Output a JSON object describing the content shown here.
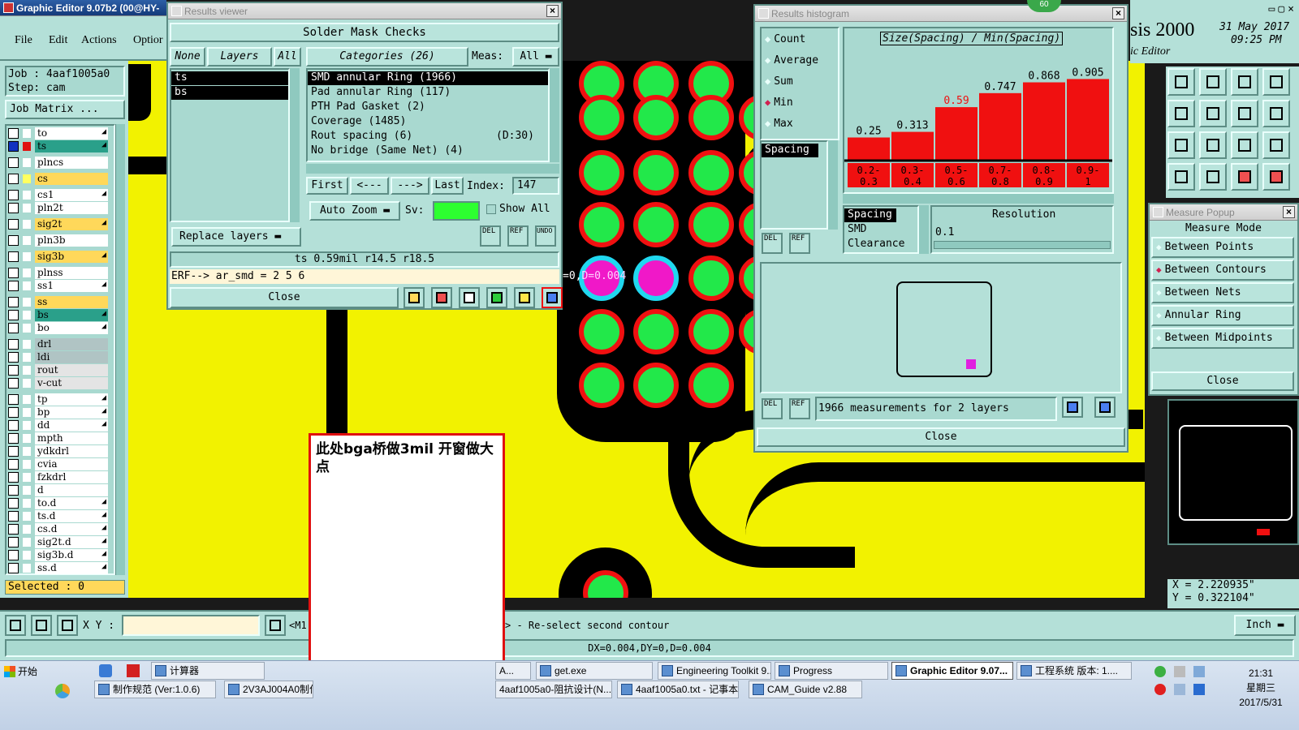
{
  "main_window": {
    "title": "Graphic Editor 9.07b2 (00@HY-H",
    "menu": [
      "File",
      "Edit",
      "Actions",
      "Optior"
    ],
    "job_label": "Job : 4aaf1005a0",
    "step_label": "Step: cam",
    "job_matrix_button": "Job Matrix ...",
    "selected_status": "Selected : 0",
    "app_brand": "sis 2000",
    "app_subtitle": "ic Editor",
    "date": "31 May 2017",
    "time": "09:25 PM",
    "indicator": "60"
  },
  "layers": [
    {
      "name": "to",
      "color": "#ffffff",
      "swatch": "#ffffff",
      "arrow": true
    },
    {
      "name": "ts",
      "color": "#2aa08a",
      "swatch": "#e01010",
      "arrow": true,
      "active": true
    },
    {
      "name": "plncs",
      "color": "#ffffff",
      "swatch": "#ffffff",
      "arrow": false
    },
    {
      "name": "cs",
      "color": "#ffd85a",
      "swatch": "#ffff60",
      "arrow": false
    },
    {
      "name": "cs1",
      "color": "#ffffff",
      "swatch": "#ffffff",
      "arrow": true
    },
    {
      "name": "pln2t",
      "color": "#ffffff",
      "swatch": "#ffffff",
      "arrow": false
    },
    {
      "name": "sig2t",
      "color": "#ffd85a",
      "swatch": "#ffffff",
      "arrow": true
    },
    {
      "name": "pln3b",
      "color": "#ffffff",
      "swatch": "#ffffff",
      "arrow": false
    },
    {
      "name": "sig3b",
      "color": "#ffd85a",
      "swatch": "#ffffff",
      "arrow": true
    },
    {
      "name": "plnss",
      "color": "#ffffff",
      "swatch": "#ffffff",
      "arrow": false
    },
    {
      "name": "ss1",
      "color": "#ffffff",
      "swatch": "#ffffff",
      "arrow": true
    },
    {
      "name": "ss",
      "color": "#ffd85a",
      "swatch": "#ffffff",
      "arrow": false
    },
    {
      "name": "bs",
      "color": "#2aa08a",
      "swatch": "#ffffff",
      "arrow": true
    },
    {
      "name": "bo",
      "color": "#ffffff",
      "swatch": "#ffffff",
      "arrow": true
    },
    {
      "name": "drl",
      "color": "#b0c4c4",
      "swatch": "#ffffff",
      "arrow": false
    },
    {
      "name": "ldi",
      "color": "#b0c4c4",
      "swatch": "#ffffff",
      "arrow": false
    },
    {
      "name": "rout",
      "color": "#e4e4e4",
      "swatch": "#ffffff",
      "arrow": false
    },
    {
      "name": "v-cut",
      "color": "#e4e4e4",
      "swatch": "#ffffff",
      "arrow": false
    },
    {
      "name": "tp",
      "color": "#ffffff",
      "swatch": "#ffffff",
      "arrow": true
    },
    {
      "name": "bp",
      "color": "#ffffff",
      "swatch": "#ffffff",
      "arrow": true
    },
    {
      "name": "dd",
      "color": "#ffffff",
      "swatch": "#ffffff",
      "arrow": true
    },
    {
      "name": "mpth",
      "color": "#ffffff",
      "swatch": "#ffffff",
      "arrow": false
    },
    {
      "name": "ydkdrl",
      "color": "#ffffff",
      "swatch": "#ffffff",
      "arrow": false
    },
    {
      "name": "cvia",
      "color": "#ffffff",
      "swatch": "#ffffff",
      "arrow": false
    },
    {
      "name": "fzkdrl",
      "color": "#ffffff",
      "swatch": "#ffffff",
      "arrow": false
    },
    {
      "name": "d",
      "color": "#ffffff",
      "swatch": "#ffffff",
      "arrow": false
    },
    {
      "name": "to.d",
      "color": "#ffffff",
      "swatch": "#ffffff",
      "arrow": true
    },
    {
      "name": "ts.d",
      "color": "#ffffff",
      "swatch": "#ffffff",
      "arrow": true
    },
    {
      "name": "cs.d",
      "color": "#ffffff",
      "swatch": "#ffffff",
      "arrow": true
    },
    {
      "name": "sig2t.d",
      "color": "#ffffff",
      "swatch": "#ffffff",
      "arrow": true
    },
    {
      "name": "sig3b.d",
      "color": "#ffffff",
      "swatch": "#ffffff",
      "arrow": true
    },
    {
      "name": "ss.d",
      "color": "#ffffff",
      "swatch": "#ffffff",
      "arrow": true
    }
  ],
  "results_viewer": {
    "title": "Results viewer",
    "header": "Solder Mask Checks",
    "layer_tabs": [
      "None",
      "Layers",
      "All"
    ],
    "layers": [
      "ts",
      "bs"
    ],
    "categories_label": "Categories (26)",
    "meas_label": "Meas:",
    "meas_value": "All",
    "categories": [
      {
        "label": "SMD annular Ring (1966)",
        "extra": "",
        "selected": true
      },
      {
        "label": "Pad annular Ring (117)",
        "extra": "",
        "selected": false
      },
      {
        "label": "PTH Pad Gasket (2)",
        "extra": "",
        "selected": false
      },
      {
        "label": "Coverage (1485)",
        "extra": "",
        "selected": false
      },
      {
        "label": "Rout spacing (6)",
        "extra": "(D:30)",
        "selected": false
      },
      {
        "label": "No bridge (Same Net) (4)",
        "extra": "",
        "selected": false
      }
    ],
    "nav": {
      "first": "First",
      "prev": "<---",
      "next": "--->",
      "last": "Last",
      "index_label": "Index:",
      "index_value": "147"
    },
    "replace_layers": "Replace layers",
    "auto_zoom": "Auto Zoom",
    "sv_label": "Sv:",
    "show_all": "Show All",
    "small_buttons": [
      "DEL",
      "REF",
      "UNDO"
    ],
    "status_line": "ts 0.59mil   r14.5   r18.5",
    "erf_line": "ERF--> ar_smd = 2 5 6",
    "close": "Close"
  },
  "histogram": {
    "title": "Results histogram",
    "options": [
      {
        "label": "Count",
        "selected": false
      },
      {
        "label": "Average",
        "selected": false
      },
      {
        "label": "Sum",
        "selected": false
      },
      {
        "label": "Min",
        "selected": true
      },
      {
        "label": "Max",
        "selected": false
      }
    ],
    "chart_title": "Size(Spacing) / Min(Spacing)",
    "list_item": "Spacing",
    "mode_list": [
      "Spacing",
      "SMD",
      "Clearance"
    ],
    "resolution_label": "Resolution",
    "resolution_value": "0.1",
    "footer": "1966 measurements for 2 layers",
    "close": "Close",
    "small_buttons": [
      "DEL",
      "REF"
    ]
  },
  "chart_data": {
    "type": "bar",
    "title": "Size(Spacing) / Min(Spacing)",
    "categories": [
      "0.2-0.3",
      "0.3-0.4",
      "0.5-0.6",
      "0.7-0.8",
      "0.8-0.9",
      "0.9-1"
    ],
    "category_lines": [
      [
        "0.2-",
        "0.3"
      ],
      [
        "0.3-",
        "0.4"
      ],
      [
        "0.5-",
        "0.6"
      ],
      [
        "0.7-",
        "0.8"
      ],
      [
        "0.8-",
        "0.9"
      ],
      [
        "0.9-",
        "1"
      ]
    ],
    "values": [
      0.25,
      0.313,
      0.59,
      0.747,
      0.868,
      0.905
    ],
    "value_labels": [
      "0.25",
      "0.313",
      "0.59",
      "0.747",
      "0.868",
      "0.905"
    ],
    "highlight_index": 2,
    "bar_color": "#f01010",
    "ylim": [
      0,
      1
    ]
  },
  "measure_popup": {
    "title": "Measure Popup",
    "mode_title": "Measure Mode",
    "modes": [
      {
        "label": "Between Points",
        "selected": false
      },
      {
        "label": "Between Contours",
        "selected": true
      },
      {
        "label": "Between Nets",
        "selected": false
      },
      {
        "label": "Annular Ring",
        "selected": false
      },
      {
        "label": "Between Midpoints",
        "selected": false
      }
    ],
    "close": "Close",
    "x_readout": "X = 2.220935\"",
    "y_readout": "Y = 0.322104\""
  },
  "canvas": {
    "measure_label_prefix": "=0,",
    "measure_label": "D=0.004",
    "annotation_text": "此处bga桥做3mil 开窗做大点"
  },
  "bottom_bar": {
    "xy_label": "X Y :",
    "xy_value": "",
    "m1_label": "<M1",
    "prompt": "> - Re-select second contour",
    "unit": "Inch",
    "delta_line": "DX=0.004,DY=0,D=0.004"
  },
  "taskbar": {
    "start": "开始",
    "row1": [
      "计算器",
      "A...",
      "get.exe",
      "Engineering Toolkit 9....",
      "Progress",
      "Graphic Editor 9.07...",
      "工程系统  版本: 1...."
    ],
    "row2": [
      "制作规范 (Ver:1.0.6)",
      "2V3AJ004A0制作",
      "4aaf1005a0-阻抗设计(N...",
      "4aaf1005a0.txt - 记事本",
      "CAM_Guide v2.88"
    ],
    "clock_time": "21:31",
    "clock_day": "星期三",
    "clock_date": "2017/5/31"
  }
}
